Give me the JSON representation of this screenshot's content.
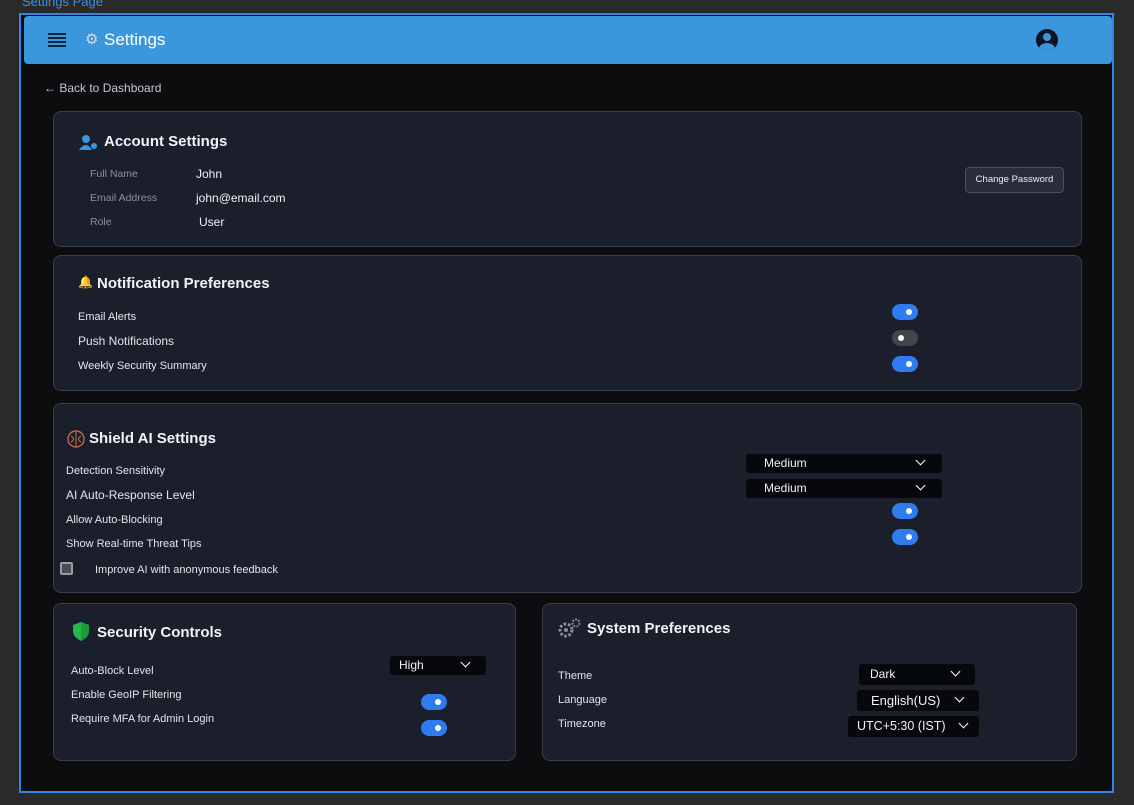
{
  "caption": "Settings Page",
  "appbar": {
    "title": "Settings"
  },
  "nav": {
    "back": "← Back to Dashboard"
  },
  "account": {
    "title": "Account Settings",
    "fields": [
      {
        "label": "Full Name",
        "value": "John"
      },
      {
        "label": "Email Address",
        "value": "john@email.com"
      },
      {
        "label": "Role",
        "value": "User"
      }
    ],
    "change_password": "Change Password"
  },
  "notifications": {
    "title": "Notification Preferences",
    "items": [
      {
        "label": "Email Alerts",
        "on": true
      },
      {
        "label": "Push Notifications",
        "on": false
      },
      {
        "label": "Weekly Security Summary",
        "on": true
      }
    ]
  },
  "shield_ai": {
    "title": "Shield AI Settings",
    "detection_label": "Detection Sensitivity",
    "detection_value": "Medium",
    "response_label": "AI Auto-Response Level",
    "response_value": "Medium",
    "auto_block_label": "Allow Auto-Blocking",
    "auto_block_on": true,
    "tips_label": "Show Real-time Threat Tips",
    "tips_on": true,
    "feedback_label": "Improve AI with anonymous feedback",
    "feedback_checked": false
  },
  "security": {
    "title": "Security Controls",
    "auto_block_level_label": "Auto-Block Level",
    "auto_block_level_value": "High",
    "geoip_label": "Enable GeoIP Filtering",
    "geoip_on": true,
    "mfa_label": "Require MFA for Admin Login",
    "mfa_on": true
  },
  "system": {
    "title": "System Preferences",
    "theme_label": "Theme",
    "theme_value": "Dark",
    "language_label": "Language",
    "language_value": "English(US)",
    "timezone_label": "Timezone",
    "timezone_value": "UTC+5:30 (IST)"
  },
  "colors": {
    "appbar": "#3a97de",
    "toggle_on": "#2f7bf0",
    "card_bg": "#1b1e2b"
  }
}
